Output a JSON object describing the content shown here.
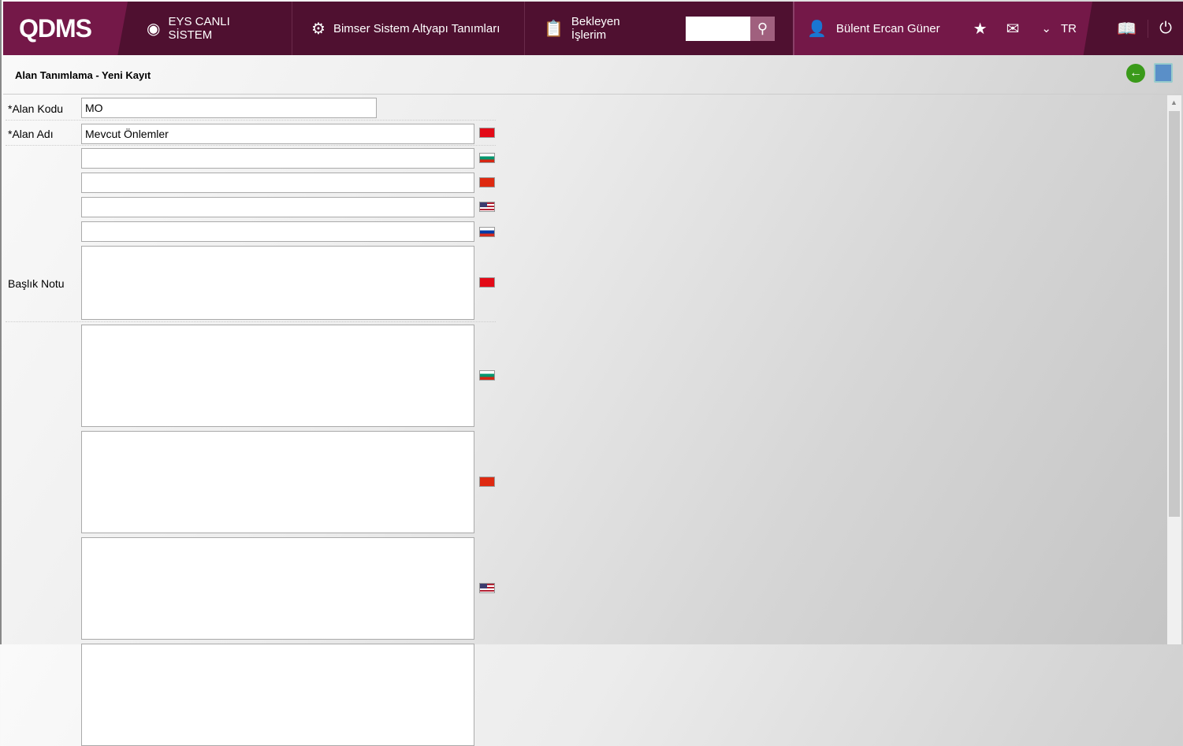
{
  "header": {
    "logo": "QDMS",
    "nav": [
      {
        "label": "EYS CANLI SİSTEM"
      },
      {
        "label": "Bimser Sistem Altyapı Tanımları"
      },
      {
        "label": "Bekleyen İşlerim"
      }
    ],
    "search_placeholder": "",
    "user": "Bülent Ercan Güner",
    "language": "TR"
  },
  "page": {
    "title": "Alan Tanımlama - Yeni Kayıt"
  },
  "form": {
    "code_label": "*Alan Kodu",
    "code_value": "MO",
    "name_label": "*Alan Adı",
    "name_value": "Mevcut Önlemler",
    "note_label": "Başlık Notu"
  },
  "flags": {
    "tr": "C*"
  }
}
